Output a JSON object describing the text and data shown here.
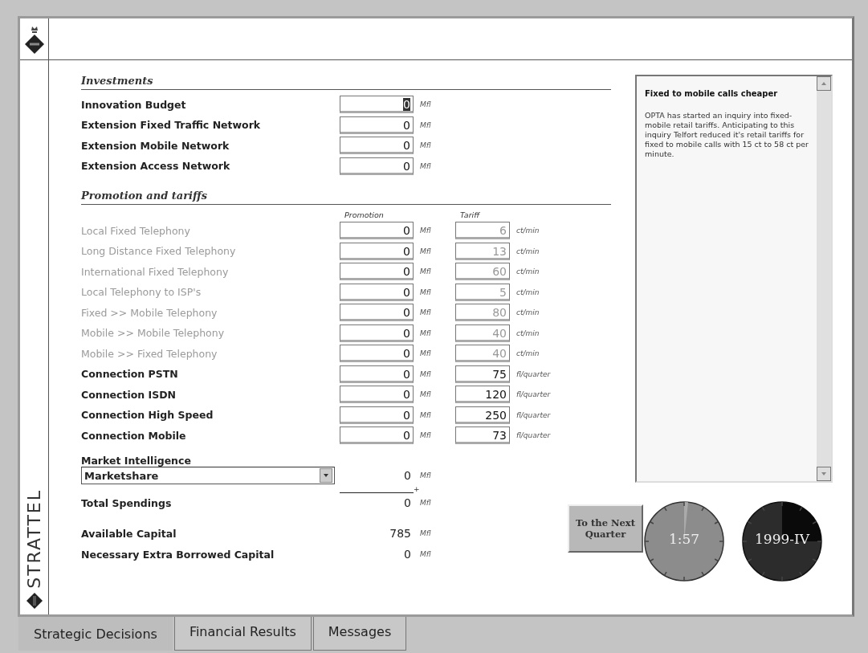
{
  "logo": {
    "text": "STRATTEL"
  },
  "investments": {
    "heading": "Investments",
    "rows": [
      {
        "label": "Innovation Budget",
        "value": "0",
        "unit": "Mfl",
        "focused": true
      },
      {
        "label": "Extension Fixed Traffic Network",
        "value": "0",
        "unit": "Mfl",
        "focused": false
      },
      {
        "label": "Extension Mobile Network",
        "value": "0",
        "unit": "Mfl",
        "focused": false
      },
      {
        "label": "Extension Access Network",
        "value": "0",
        "unit": "Mfl",
        "focused": false
      }
    ]
  },
  "promotion": {
    "heading": "Promotion and tariffs",
    "column_headers": [
      "Promotion",
      "Tariff"
    ],
    "rows": [
      {
        "label": "Local Fixed Telephony",
        "disabled": true,
        "promotion": "0",
        "promotion_unit": "Mfl",
        "tariff": "6",
        "tariff_unit": "ct/min"
      },
      {
        "label": "Long Distance Fixed Telephony",
        "disabled": true,
        "promotion": "0",
        "promotion_unit": "Mfl",
        "tariff": "13",
        "tariff_unit": "ct/min"
      },
      {
        "label": "International Fixed Telephony",
        "disabled": true,
        "promotion": "0",
        "promotion_unit": "Mfl",
        "tariff": "60",
        "tariff_unit": "ct/min"
      },
      {
        "label": "Local Telephony to ISP's",
        "disabled": true,
        "promotion": "0",
        "promotion_unit": "Mfl",
        "tariff": "5",
        "tariff_unit": "ct/min"
      },
      {
        "label": "Fixed >> Mobile Telephony",
        "disabled": true,
        "promotion": "0",
        "promotion_unit": "Mfl",
        "tariff": "80",
        "tariff_unit": "ct/min"
      },
      {
        "label": "Mobile >> Mobile Telephony",
        "disabled": true,
        "promotion": "0",
        "promotion_unit": "Mfl",
        "tariff": "40",
        "tariff_unit": "ct/min"
      },
      {
        "label": "Mobile >> Fixed Telephony",
        "disabled": true,
        "promotion": "0",
        "promotion_unit": "Mfl",
        "tariff": "40",
        "tariff_unit": "ct/min"
      },
      {
        "label": "Connection PSTN",
        "disabled": false,
        "promotion": "0",
        "promotion_unit": "Mfl",
        "tariff": "75",
        "tariff_unit": "fl/quarter"
      },
      {
        "label": "Connection ISDN",
        "disabled": false,
        "promotion": "0",
        "promotion_unit": "Mfl",
        "tariff": "120",
        "tariff_unit": "fl/quarter"
      },
      {
        "label": "Connection High Speed",
        "disabled": false,
        "promotion": "0",
        "promotion_unit": "Mfl",
        "tariff": "250",
        "tariff_unit": "fl/quarter"
      },
      {
        "label": "Connection Mobile",
        "disabled": false,
        "promotion": "0",
        "promotion_unit": "Mfl",
        "tariff": "73",
        "tariff_unit": "fl/quarter"
      }
    ]
  },
  "market_intelligence": {
    "label": "Market Intelligence",
    "selection": "Marketshare",
    "amount": "0",
    "unit": "Mfl",
    "plus": "+"
  },
  "totals": [
    {
      "label": "Total Spendings",
      "value": "0",
      "unit": "Mfl"
    },
    {
      "label": "Available Capital",
      "value": "785",
      "unit": "Mfl"
    },
    {
      "label": "Necessary Extra Borrowed Capital",
      "value": "0",
      "unit": "Mfl"
    }
  ],
  "next_button": "To the Next Quarter",
  "message": {
    "title": "Fixed to mobile calls cheaper",
    "body": "OPTA has started an inquiry into fixed-mobile retail tariffs. Anticipating to this inquiry Telfort reduced it's retail tariffs for fixed to mobile calls with 15 ct to 58 ct per minute."
  },
  "dials": [
    {
      "text": "1:57"
    },
    {
      "text": "1999-IV"
    }
  ],
  "tabs": [
    {
      "label": "Strategic Decisions",
      "selected": true
    },
    {
      "label": "Financial Results",
      "selected": false
    },
    {
      "label": "Messages",
      "selected": false
    }
  ]
}
